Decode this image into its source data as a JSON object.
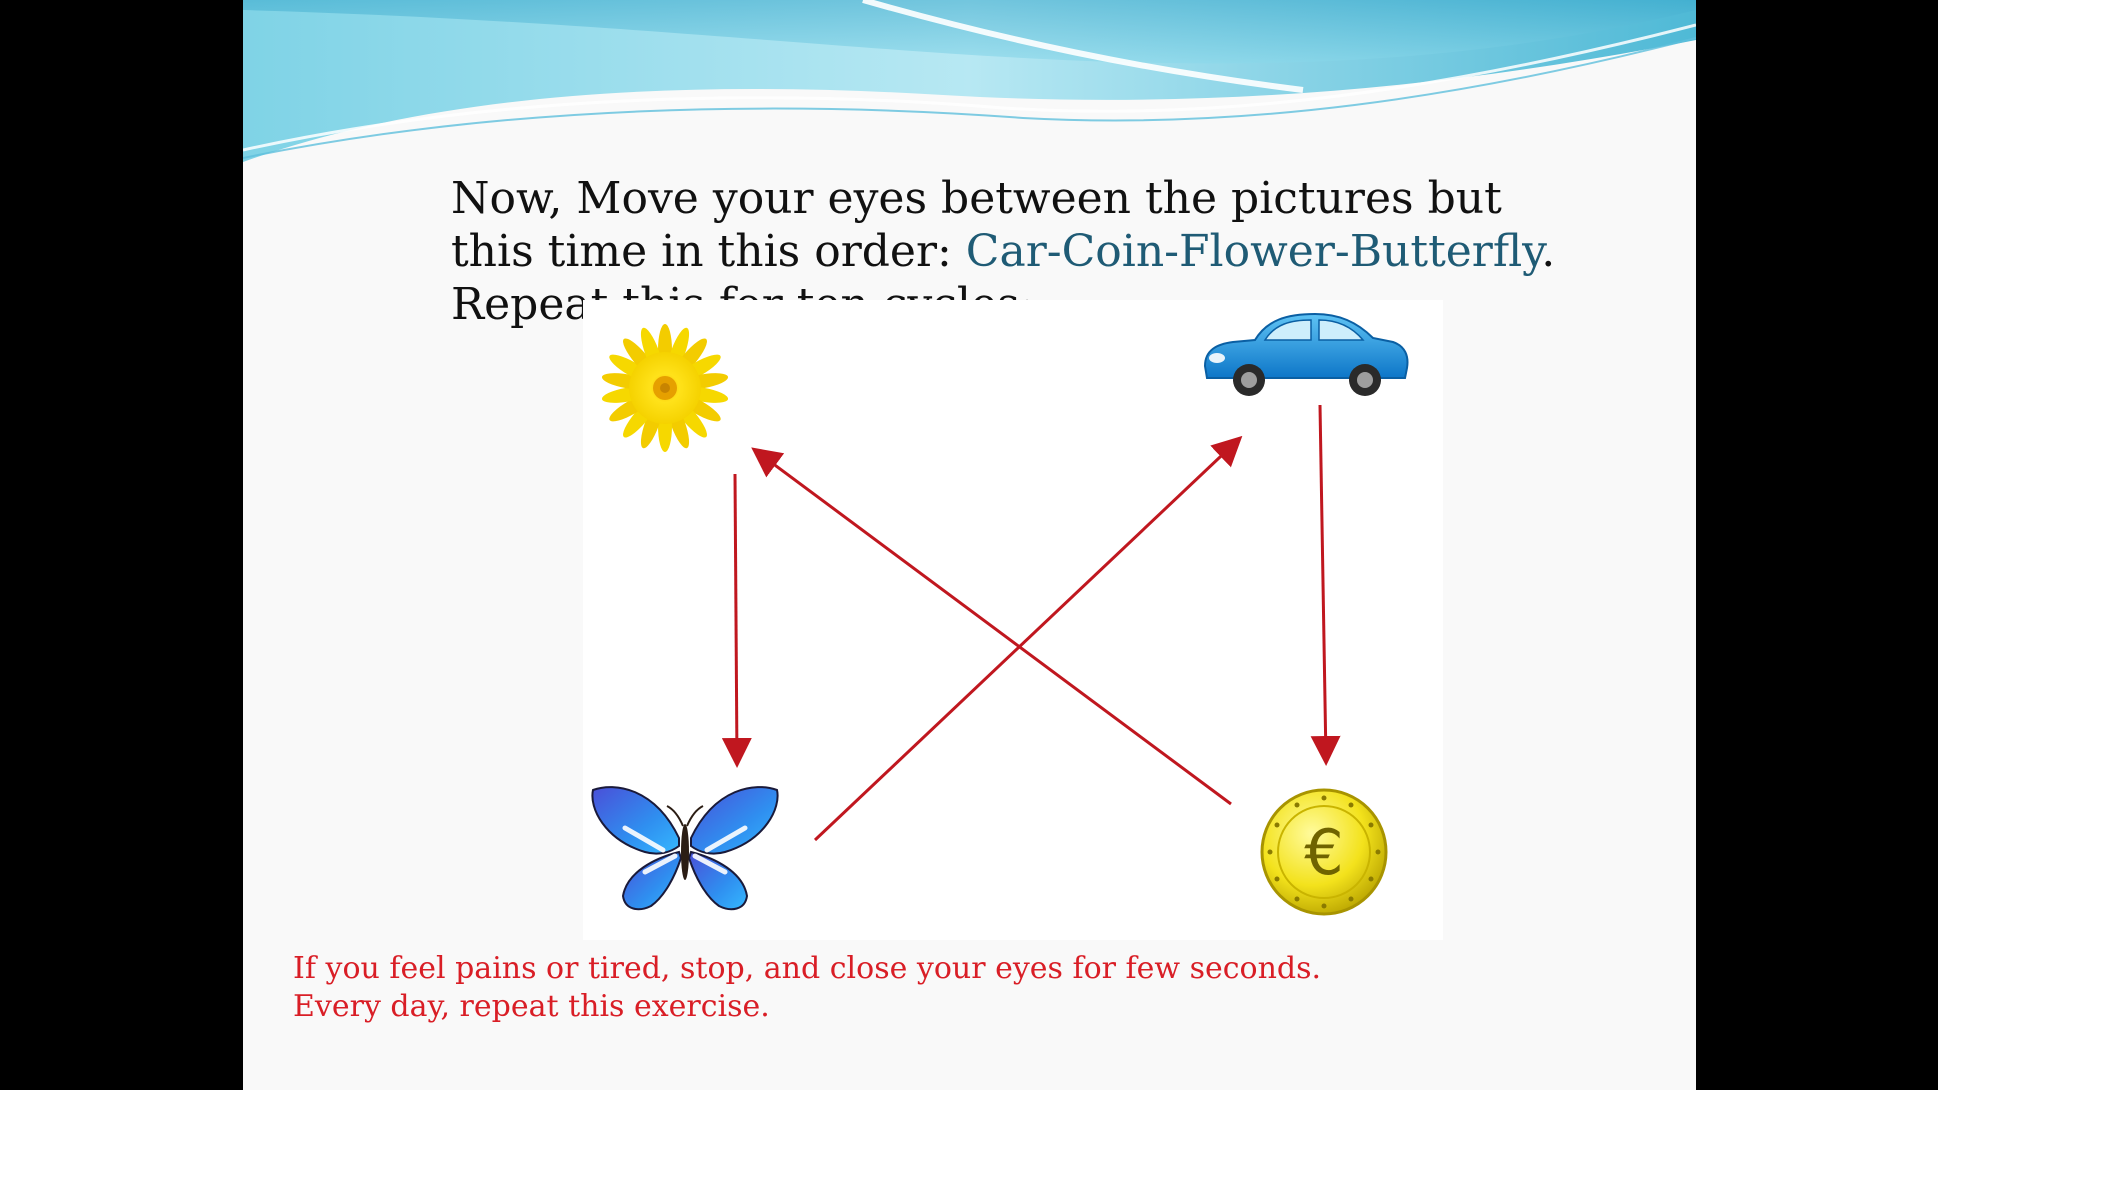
{
  "slide": {
    "title_part1": "Now, Move your eyes between the pictures but this time in this order: ",
    "title_highlight": "Car-Coin-Flower-Butterfly",
    "title_part2": ". Repeat this for ten cycles:",
    "warning_line1": "If you feel pains or tired, stop, and close your eyes for few seconds.",
    "warning_line2": "Every day, repeat this exercise."
  },
  "pictures": {
    "flower": "flower-icon",
    "car": "car-icon",
    "butterfly": "butterfly-icon",
    "coin": "euro-coin-icon",
    "coin_symbol": "€"
  },
  "colors": {
    "arrow": "#c0171f",
    "highlight": "#1f5b75",
    "warning": "#d91e26",
    "wave": "#5bc0de",
    "letterbox": "#000000"
  }
}
